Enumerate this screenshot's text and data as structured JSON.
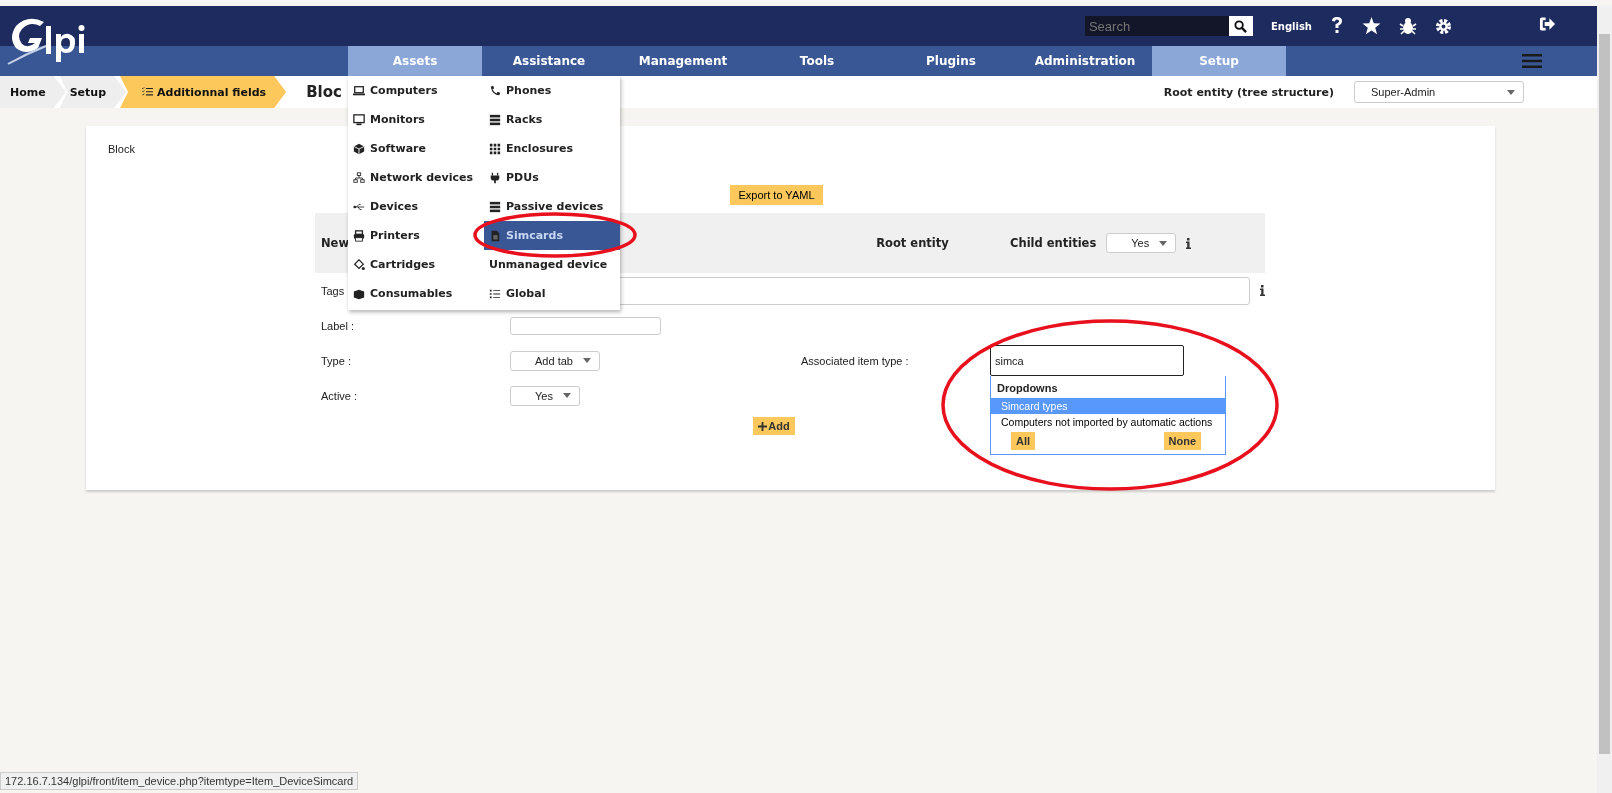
{
  "header": {
    "search_placeholder": "Search",
    "language": "English"
  },
  "nav": [
    {
      "label": "Assets",
      "selected": true
    },
    {
      "label": "Assistance",
      "selected": false
    },
    {
      "label": "Management",
      "selected": false
    },
    {
      "label": "Tools",
      "selected": false
    },
    {
      "label": "Plugins",
      "selected": false
    },
    {
      "label": "Administration",
      "selected": false
    },
    {
      "label": "Setup",
      "selected": true
    }
  ],
  "breadcrumbs": [
    {
      "label": "Home",
      "current": false
    },
    {
      "label": "Setup",
      "current": false
    },
    {
      "label": "Additionnal fields",
      "current": true
    }
  ],
  "page_title": "Bloc",
  "entity": "Root entity (tree structure)",
  "profile": "Super-Admin",
  "card": {
    "title": "Block",
    "export_button": "Export to YAML",
    "header_row": {
      "name": "New",
      "root_entity": "Root entity",
      "child_entities_label": "Child entities",
      "child_entities_value": "Yes"
    },
    "fields": [
      {
        "label": "Tags",
        "kind": "wide"
      },
      {
        "label": "Label :",
        "kind": "text"
      },
      {
        "label": "Type :",
        "kind": "select",
        "value": "Add tab"
      },
      {
        "label": "Active :",
        "kind": "select",
        "value": "Yes"
      }
    ],
    "associated_label": "Associated item type :",
    "associated_value": "simca",
    "add_button": "Add"
  },
  "menu": {
    "items": [
      {
        "label": "Computers",
        "kind": "laptop",
        "selected": false
      },
      {
        "label": "Phones",
        "kind": "phone",
        "selected": false
      },
      {
        "label": "Monitors",
        "kind": "monitor",
        "selected": false
      },
      {
        "label": "Racks",
        "kind": "rack",
        "selected": false
      },
      {
        "label": "Software",
        "kind": "cube",
        "selected": false
      },
      {
        "label": "Enclosures",
        "kind": "grid",
        "selected": false
      },
      {
        "label": "Network devices",
        "kind": "network",
        "selected": false
      },
      {
        "label": "PDUs",
        "kind": "plug",
        "selected": false
      },
      {
        "label": "Devices",
        "kind": "usb",
        "selected": false
      },
      {
        "label": "Passive devices",
        "kind": "rack",
        "selected": false
      },
      {
        "label": "Printers",
        "kind": "printer",
        "selected": false
      },
      {
        "label": "Simcards",
        "kind": "sim",
        "selected": true
      },
      {
        "label": "Cartridges",
        "kind": "bucket",
        "selected": false
      },
      {
        "label": "Unmanaged device",
        "kind": "none",
        "selected": false
      },
      {
        "label": "Consumables",
        "kind": "box",
        "selected": false
      },
      {
        "label": "Global",
        "kind": "list",
        "selected": false
      }
    ]
  },
  "autocomplete": {
    "group": "Dropdowns",
    "options": [
      {
        "label": "Simcard types",
        "selected": true
      },
      {
        "label": "Computers not imported by automatic actions",
        "selected": false
      }
    ],
    "buttons": [
      "All",
      "None"
    ]
  },
  "status_url": "172.16.7.134/glpi/front/item_device.php?itemtype=Item_DeviceSimcard"
}
